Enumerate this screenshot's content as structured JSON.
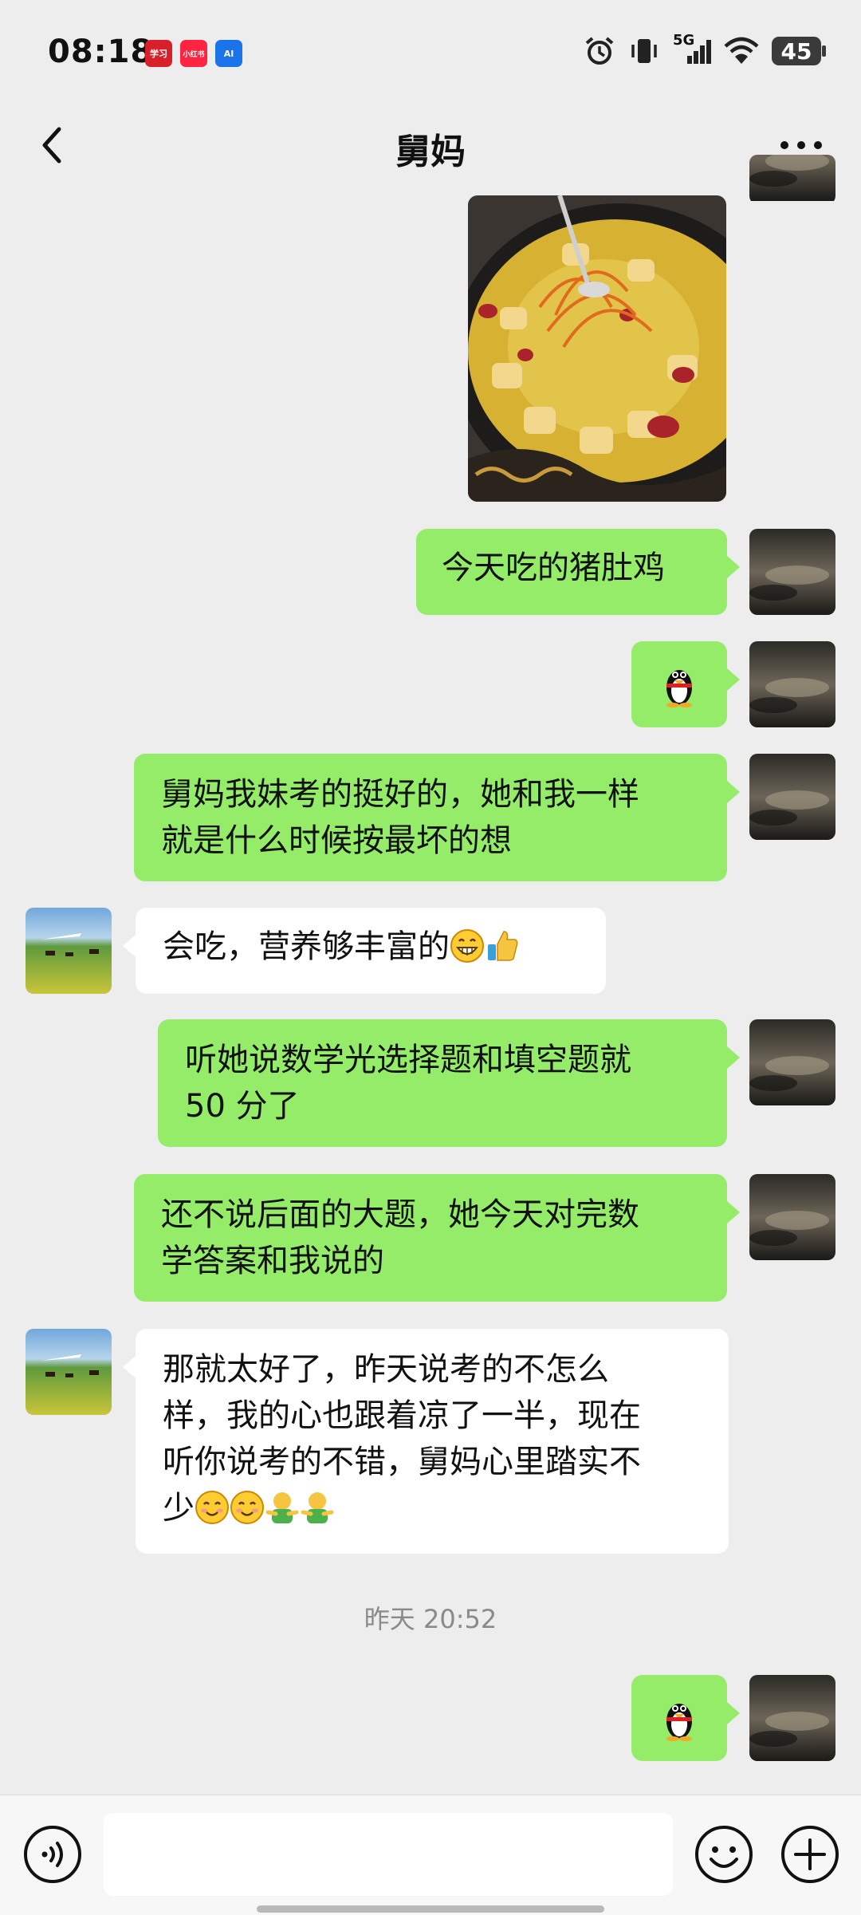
{
  "status_bar": {
    "time": "08:18",
    "apps": [
      {
        "name": "学习强国",
        "color": "#d8202a",
        "label": "学习"
      },
      {
        "name": "小红书",
        "color": "#ff2442",
        "label": "小红书"
      },
      {
        "name": "AI助手",
        "color": "#1a73e8",
        "label": "AI"
      }
    ],
    "network": "5G",
    "battery": "45"
  },
  "header": {
    "title": "舅妈"
  },
  "messages": [
    {
      "side": "me",
      "type": "image",
      "description_icon": "food-photo"
    },
    {
      "side": "me",
      "type": "text",
      "text": "今天吃的猪肚鸡"
    },
    {
      "side": "me",
      "type": "sticker",
      "icon": "penguin-icon"
    },
    {
      "side": "me",
      "type": "text",
      "lines": [
        "舅妈我妹考的挺好的，她和我一样",
        "就是什么时候按最坏的想"
      ]
    },
    {
      "side": "other",
      "type": "text",
      "text": "会吃，营养够丰富的",
      "emojis": [
        "grin-icon",
        "thumbs-up-icon"
      ]
    },
    {
      "side": "me",
      "type": "text",
      "lines": [
        "听她说数学光选择题和填空题就",
        "50 分了"
      ]
    },
    {
      "side": "me",
      "type": "text",
      "lines": [
        "还不说后面的大题，她今天对完数",
        "学答案和我说的"
      ]
    },
    {
      "side": "other",
      "type": "text",
      "lines": [
        "那就太好了，昨天说考的不怎么",
        "样，我的心也跟着凉了一半，现在",
        "听你说考的不错，舅妈心里踏实不",
        "少"
      ],
      "emojis": [
        "smile-icon",
        "smile-icon",
        "hug-icon",
        "hug-icon"
      ]
    },
    {
      "side": "me",
      "type": "sticker",
      "icon": "penguin-icon"
    }
  ],
  "timestamp": "昨天 20:52",
  "colors": {
    "background": "#ededed",
    "my_bubble": "#95ec69",
    "other_bubble": "#ffffff"
  }
}
